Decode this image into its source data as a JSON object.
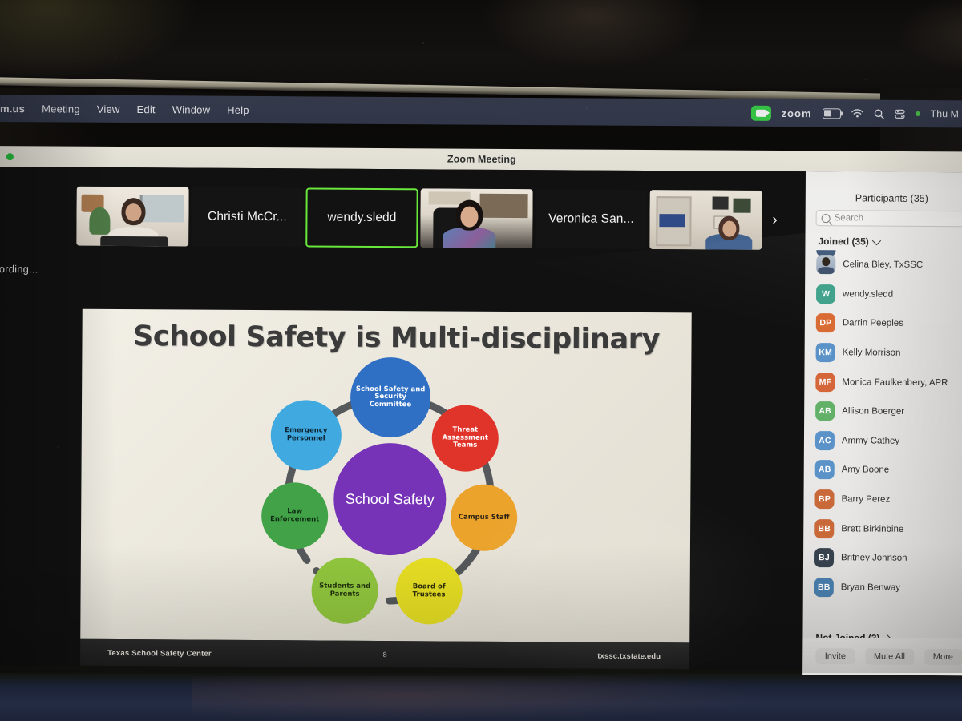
{
  "menubar": {
    "app_label": "m.us",
    "items": [
      "Meeting",
      "View",
      "Edit",
      "Window",
      "Help"
    ],
    "status_zoom_label": "zoom",
    "status_time": "Thu M",
    "icons": [
      "zoom-camera-icon",
      "battery-icon",
      "wifi-icon",
      "search-icon",
      "control-center-icon"
    ]
  },
  "window": {
    "title": "Zoom Meeting",
    "recording_status": "Recording..."
  },
  "filmstrip": {
    "tiles": [
      {
        "name": "",
        "type": "video",
        "active": false
      },
      {
        "name": "Christi McCr...",
        "type": "name",
        "active": false
      },
      {
        "name": "wendy.sledd",
        "type": "name",
        "active": true
      },
      {
        "name": "",
        "type": "video",
        "active": false
      },
      {
        "name": "Veronica San...",
        "type": "name",
        "active": false
      },
      {
        "name": "",
        "type": "video",
        "active": false
      }
    ],
    "next_arrow": "›"
  },
  "slide": {
    "title": "School Safety is Multi-disciplinary",
    "footer_left": "Texas School Safety Center",
    "footer_page": "8",
    "footer_right": "txssc.txstate.edu",
    "diagram": {
      "center": "School Safety",
      "center_color": "#7733b8",
      "nodes": [
        {
          "label": "School Safety and Security Committee",
          "color": "#2f6fc4"
        },
        {
          "label": "Threat Assessment Teams",
          "color": "#e0342a"
        },
        {
          "label": "Campus Staff",
          "color": "#eba32c"
        },
        {
          "label": "Board of Trustees",
          "color": "#e8e023"
        },
        {
          "label": "Students and Parents",
          "color": "#92c83e"
        },
        {
          "label": "Law Enforcement",
          "color": "#41a247"
        },
        {
          "label": "Emergency Personnel",
          "color": "#3fa9e0"
        }
      ]
    }
  },
  "participants": {
    "title": "Participants (35)",
    "search_placeholder": "Search",
    "joined_label": "Joined (35)",
    "not_joined_label": "Not Joined (3)",
    "list": [
      {
        "name": "Celina Bley, TxSSC",
        "initials": "",
        "color": "photo"
      },
      {
        "name": "wendy.sledd",
        "initials": "W",
        "color": "#3fa18a"
      },
      {
        "name": "Darrin Peeples",
        "initials": "DP",
        "color": "#d96a33"
      },
      {
        "name": "Kelly Morrison",
        "initials": "KM",
        "color": "#5b93c9"
      },
      {
        "name": "Monica Faulkenbery, APR",
        "initials": "MF",
        "color": "#d4663a"
      },
      {
        "name": "Allison Boerger",
        "initials": "AB",
        "color": "#63b168"
      },
      {
        "name": "Ammy Cathey",
        "initials": "AC",
        "color": "#5b93c9"
      },
      {
        "name": "Amy Boone",
        "initials": "AB",
        "color": "#5b93c9"
      },
      {
        "name": "Barry Perez",
        "initials": "BP",
        "color": "#c9693a"
      },
      {
        "name": "Brett Birkinbine",
        "initials": "BB",
        "color": "#c9693a"
      },
      {
        "name": "Britney Johnson",
        "initials": "BJ",
        "color": "#37424f"
      },
      {
        "name": "Bryan Benway",
        "initials": "BB",
        "color": "#4a7fae"
      }
    ],
    "buttons": [
      "Invite",
      "Mute All",
      "More"
    ]
  }
}
